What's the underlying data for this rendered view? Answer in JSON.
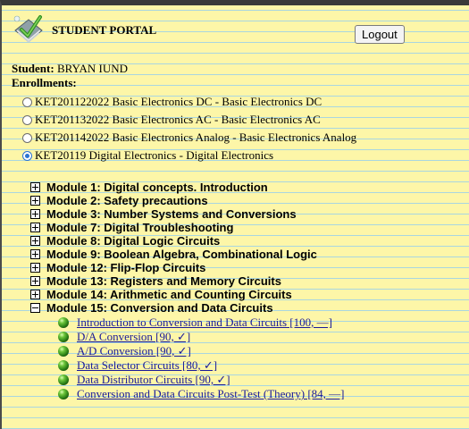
{
  "header": {
    "title": "STUDENT PORTAL",
    "logout_label": "Logout"
  },
  "student": {
    "label": "Student:",
    "name": "BRYAN IUND"
  },
  "enrollments": {
    "label": "Enrollments:",
    "items": [
      {
        "label": "KET201122022 Basic Electronics DC - Basic Electronics DC",
        "selected": false
      },
      {
        "label": "KET201132022 Basic Electronics AC - Basic Electronics AC",
        "selected": false
      },
      {
        "label": "KET201142022 Basic Electronics Analog - Basic Electronics Analog",
        "selected": false
      },
      {
        "label": "KET20119 Digital Electronics - Digital Electronics",
        "selected": true
      }
    ]
  },
  "modules": [
    {
      "label": "Module 1: Digital concepts. Introduction",
      "expanded": false
    },
    {
      "label": "Module 2: Safety precautions",
      "expanded": false
    },
    {
      "label": "Module 3: Number Systems and Conversions",
      "expanded": false
    },
    {
      "label": "Module 7: Digital Troubleshooting",
      "expanded": false
    },
    {
      "label": "Module 8: Digital Logic Circuits",
      "expanded": false
    },
    {
      "label": "Module 9: Boolean Algebra, Combinational Logic",
      "expanded": false
    },
    {
      "label": "Module 12: Flip-Flop Circuits",
      "expanded": false
    },
    {
      "label": "Module 13: Registers and Memory Circuits",
      "expanded": false
    },
    {
      "label": "Module 14: Arithmetic and Counting Circuits",
      "expanded": false
    },
    {
      "label": "Module 15: Conversion and Data Circuits",
      "expanded": true
    }
  ],
  "lessons": [
    {
      "label": "Introduction to Conversion and Data Circuits [100, —]"
    },
    {
      "label": "D/A Conversion [90, ✓]"
    },
    {
      "label": "A/D Conversion [90, ✓]"
    },
    {
      "label": "Data Selector Circuits [80, ✓]"
    },
    {
      "label": "Data Distributor Circuits [90, ✓]"
    },
    {
      "label": "Conversion and Data Circuits Post-Test (Theory) [84, —]"
    }
  ],
  "colors": {
    "background": "#fdf6a8",
    "ruled_line": "#a9d6e0",
    "link": "#1a1a99",
    "radio_selected": "#2b73d1",
    "status_ball": "#2a7f16"
  },
  "icons": {
    "logo": "book-with-check-icon",
    "expand": "plus-box-icon",
    "collapse": "minus-box-icon",
    "status": "green-ball-icon"
  }
}
